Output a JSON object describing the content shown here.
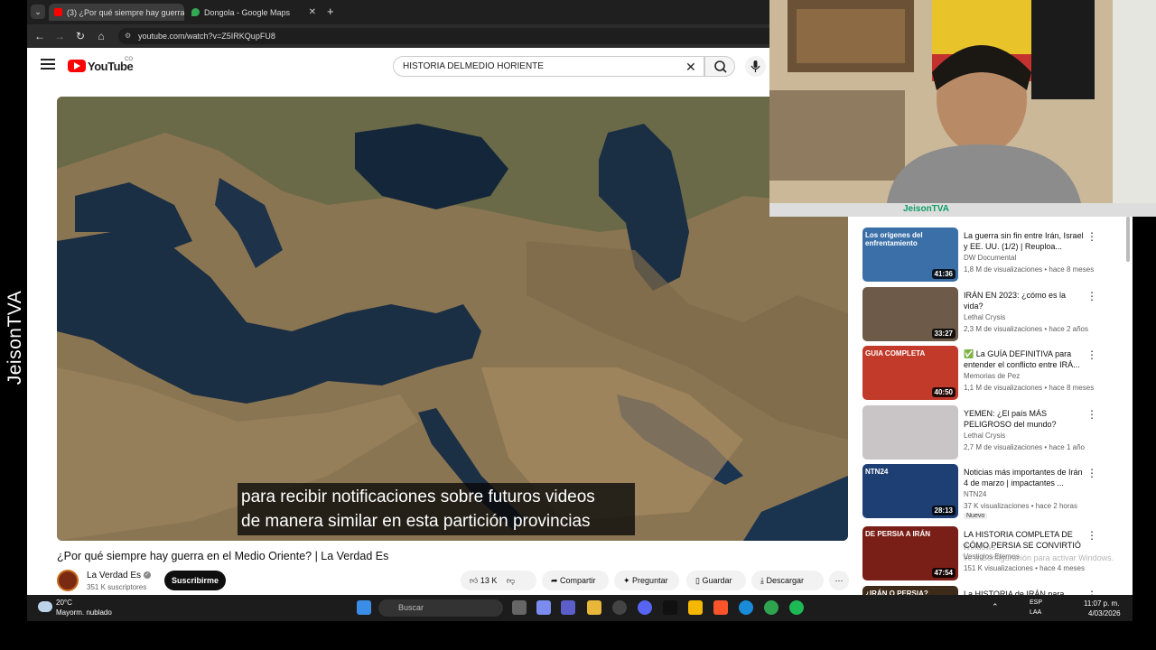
{
  "overlay": {
    "watermark": "JeisonTVA"
  },
  "browser": {
    "tabs": [
      {
        "label": "(3) ¿Por qué siempre hay guerra",
        "active": true
      },
      {
        "label": "Dongola - Google Maps",
        "active": false
      }
    ],
    "url": "youtube.com/watch?v=Z5IRKQupFU8"
  },
  "header": {
    "logo": "YouTube",
    "region": "CO",
    "search_value": "HISTORIA DELMEDIO HORIENTE"
  },
  "video": {
    "subtitle_line1": "para recibir notificaciones sobre futuros videos",
    "subtitle_line2": "de manera similar en esta partición provincias",
    "title": "¿Por qué siempre hay guerra en el Medio Oriente? | La Verdad Es",
    "channel": "La Verdad Es",
    "subscribers": "351 K suscriptores",
    "subscribe_label": "Suscribirme",
    "likes": "13 K",
    "share_label": "Compartir",
    "ask_label": "Preguntar",
    "save_label": "Guardar",
    "download_label": "Descargar"
  },
  "recommendations": [
    {
      "title": "La guerra sin fin entre Irán, Israel y EE. UU. (1/2) | Reuploa...",
      "channel": "DW Documental",
      "meta": "1,8 M de visualizaciones • hace 8 meses",
      "duration": "41:36",
      "thumb_text": "Los orígenes del enfrentamiento",
      "thumb_color": "#3b6fa8"
    },
    {
      "title": "IRÁN EN 2023: ¿cómo es la vida?",
      "channel": "Lethal Crysis",
      "meta": "2,3 M de visualizaciones • hace 2 años",
      "duration": "33:27",
      "thumb_text": "",
      "thumb_color": "#6d5a48"
    },
    {
      "title": "✅ La GUÍA DEFINITIVA para entender el conflicto entre IRÁ...",
      "channel": "Memorias de Pez",
      "meta": "1,1 M de visualizaciones • hace 8 meses",
      "duration": "40:50",
      "thumb_text": "GUIA COMPLETA",
      "thumb_color": "#c23a2a"
    },
    {
      "title": "YEMEN: ¿El país MÁS PELIGROSO del mundo?",
      "channel": "Lethal Crysis",
      "meta": "2,7 M de visualizaciones • hace 1 año",
      "duration": "",
      "thumb_text": "",
      "thumb_color": "#c9c4c6"
    },
    {
      "title": "Noticias más importantes de Irán 4 de marzo | impactantes ...",
      "channel": "NTN24",
      "meta": "37 K visualizaciones • hace 2 horas",
      "badge": "Nuevo",
      "duration": "28:13",
      "thumb_text": "NTN24",
      "thumb_color": "#1e3f73"
    },
    {
      "title": "LA HISTORIA COMPLETA DE CÓMO PERSIA SE CONVIRTIÓ ...",
      "channel": "Vestigios Eternos",
      "meta": "151 K visualizaciones • hace 4 meses",
      "duration": "47:54",
      "thumb_text": "DE PERSIA A IRÁN",
      "thumb_color": "#7a1f17"
    },
    {
      "title": "La HISTORIA de IRÁN para",
      "channel": "",
      "meta": "",
      "duration": "",
      "thumb_text": "¿IRÁN O PERSIA?",
      "thumb_color": "#3d2a18"
    }
  ],
  "webcam": {
    "name": "JeisonTVA"
  },
  "windows_watermark": {
    "line1": "Windows",
    "line2": "Ve a Configuración para activar Windows."
  },
  "taskbar": {
    "weather_temp": "20°C",
    "weather_desc": "Mayorm. nublado",
    "search_placeholder": "Buscar",
    "lang1": "ESP",
    "lang2": "LAA",
    "time": "11:07 p. m.",
    "date": "4/03/2026"
  }
}
